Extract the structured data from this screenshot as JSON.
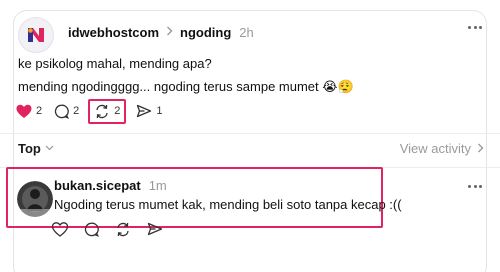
{
  "post": {
    "username": "idwebhostcom",
    "topic": "ngoding",
    "time": "2h",
    "line1": "ke psikolog mahal, mending apa?",
    "line2": "mending ngodingggg... ngoding terus sampe mumet 😭😮‍💨",
    "likes": "2",
    "comments": "2",
    "reposts": "2",
    "shares": "1"
  },
  "replies_bar": {
    "sort_label": "Top",
    "view_activity": "View activity"
  },
  "reply": {
    "username": "bukan.sicepat",
    "time": "1m",
    "text": "Ngoding terus mumet kak, mending beli soto tanpa kecap :(("
  },
  "colors": {
    "highlight": "#e0245e",
    "like": "#e0245e",
    "muted": "#9a9a9a"
  },
  "icons": [
    "heart-icon",
    "comment-icon",
    "repost-icon",
    "share-icon",
    "more-icon",
    "chevron-right-icon",
    "chevron-down-icon"
  ]
}
